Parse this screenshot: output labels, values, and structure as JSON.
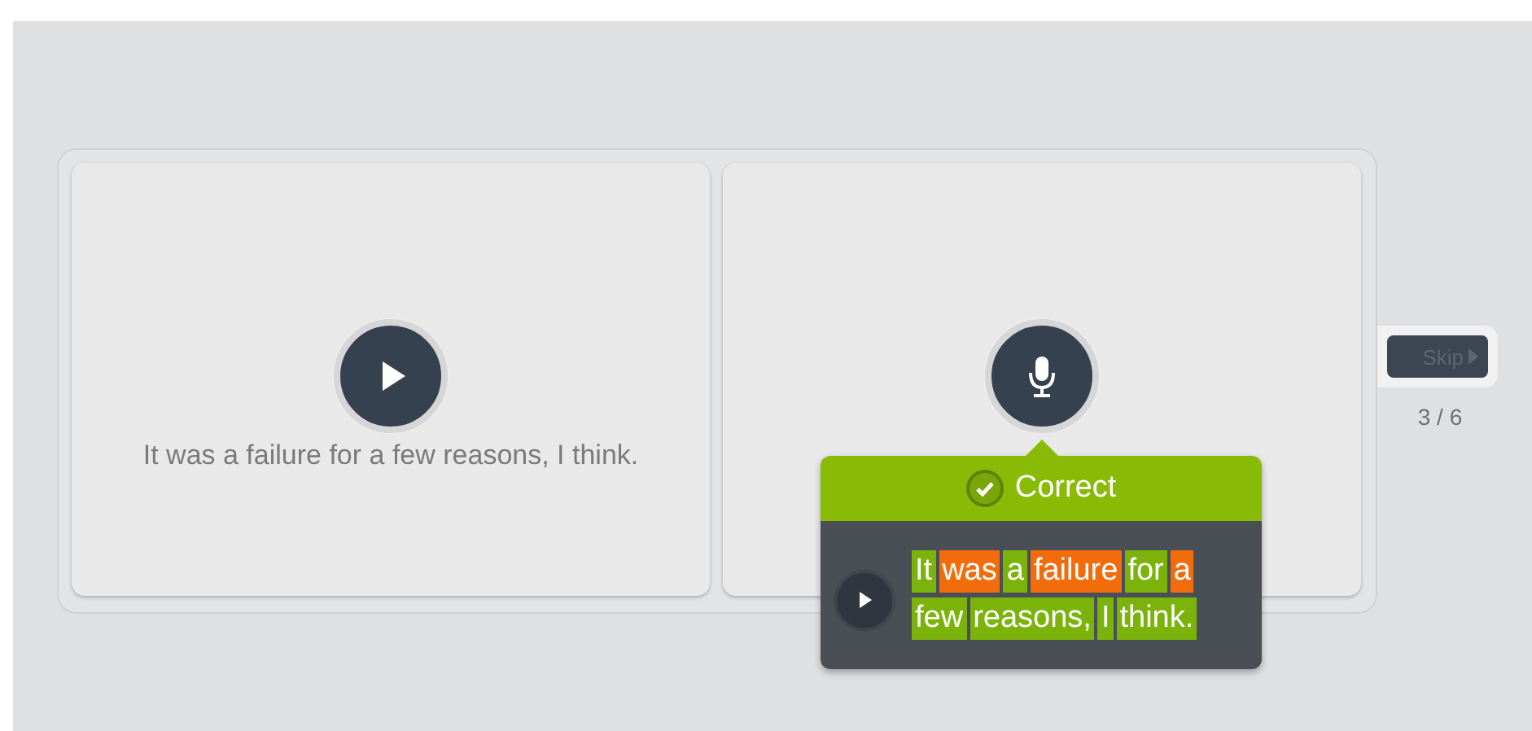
{
  "prompt_card": {
    "sentence": "It was a failure for a few reasons, I think."
  },
  "record_card": {
    "result": {
      "label": "Correct",
      "words": [
        {
          "text": "It",
          "correct": true
        },
        {
          "text": "was",
          "correct": false
        },
        {
          "text": "a",
          "correct": true
        },
        {
          "text": "failure",
          "correct": false
        },
        {
          "text": "for",
          "correct": true
        },
        {
          "text": "a",
          "correct": false
        },
        {
          "text": "few",
          "correct": true
        },
        {
          "text": "reasons,",
          "correct": true
        },
        {
          "text": "I",
          "correct": true
        },
        {
          "text": "think.",
          "correct": true
        }
      ]
    }
  },
  "skip_button": {
    "label": "Skip"
  },
  "progress": "3 / 6"
}
